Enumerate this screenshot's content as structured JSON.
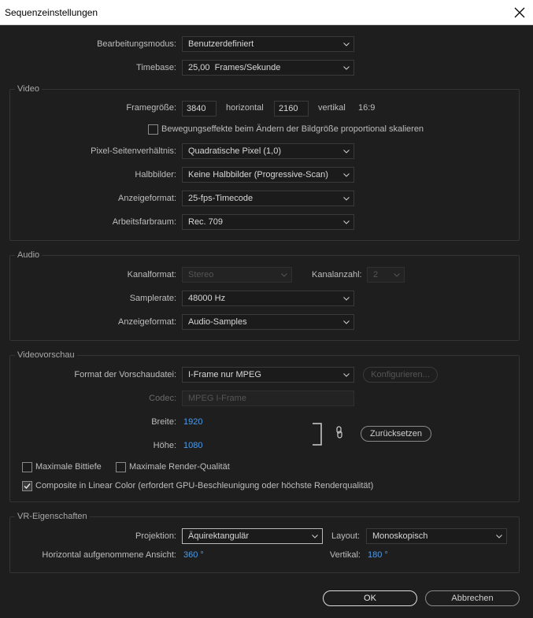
{
  "window": {
    "title": "Sequenzeinstellungen"
  },
  "general": {
    "editing_mode_label": "Bearbeitungsmodus:",
    "editing_mode_value": "Benutzerdefiniert",
    "timebase_label": "Timebase:",
    "timebase_value": "25,00  Frames/Sekunde"
  },
  "video": {
    "group_label": "Video",
    "frame_size_label": "Framegröße:",
    "frame_width": "3840",
    "horizontal_label": "horizontal",
    "frame_height": "2160",
    "vertical_label": "vertikal",
    "aspect": "16:9",
    "scale_checkbox_label": "Bewegungseffekte beim Ändern der Bildgröße proportional skalieren",
    "pixel_aspect_label": "Pixel-Seitenverhältnis:",
    "pixel_aspect_value": "Quadratische Pixel (1,0)",
    "fields_label": "Halbbilder:",
    "fields_value": "Keine Halbbilder (Progressive-Scan)",
    "display_format_label": "Anzeigeformat:",
    "display_format_value": "25-fps-Timecode",
    "working_color_label": "Arbeitsfarbraum:",
    "working_color_value": "Rec. 709"
  },
  "audio": {
    "group_label": "Audio",
    "channel_format_label": "Kanalformat:",
    "channel_format_value": "Stereo",
    "channel_count_label": "Kanalanzahl:",
    "channel_count_value": "2",
    "sample_rate_label": "Samplerate:",
    "sample_rate_value": "48000 Hz",
    "display_format_label": "Anzeigeformat:",
    "display_format_value": "Audio-Samples"
  },
  "preview": {
    "group_label": "Videovorschau",
    "preview_format_label": "Format der Vorschaudatei:",
    "preview_format_value": "I-Frame nur MPEG",
    "configure_label": "Konfigurieren...",
    "codec_label": "Codec:",
    "codec_value": "MPEG I-Frame",
    "width_label": "Breite:",
    "width_value": "1920",
    "height_label": "Höhe:",
    "height_value": "1080",
    "reset_label": "Zurücksetzen",
    "max_bit_depth_label": "Maximale Bittiefe",
    "max_render_quality_label": "Maximale Render-Qualität",
    "linear_color_label": "Composite in Linear Color (erfordert GPU-Beschleunigung oder höchste Renderqualität)"
  },
  "vr": {
    "group_label": "VR-Eigenschaften",
    "projection_label": "Projektion:",
    "projection_value": "Äquirektangulär",
    "layout_label": "Layout:",
    "layout_value": "Monoskopisch",
    "horizontal_view_label": "Horizontal aufgenommene Ansicht:",
    "horizontal_view_value": "360 °",
    "vertical_label": "Vertikal:",
    "vertical_value": "180 °"
  },
  "footer": {
    "ok_label": "OK",
    "cancel_label": "Abbrechen"
  },
  "colors": {
    "background": "#1e1e1e",
    "accent_value": "#4d9be8",
    "title_bar": "#ffffff"
  }
}
